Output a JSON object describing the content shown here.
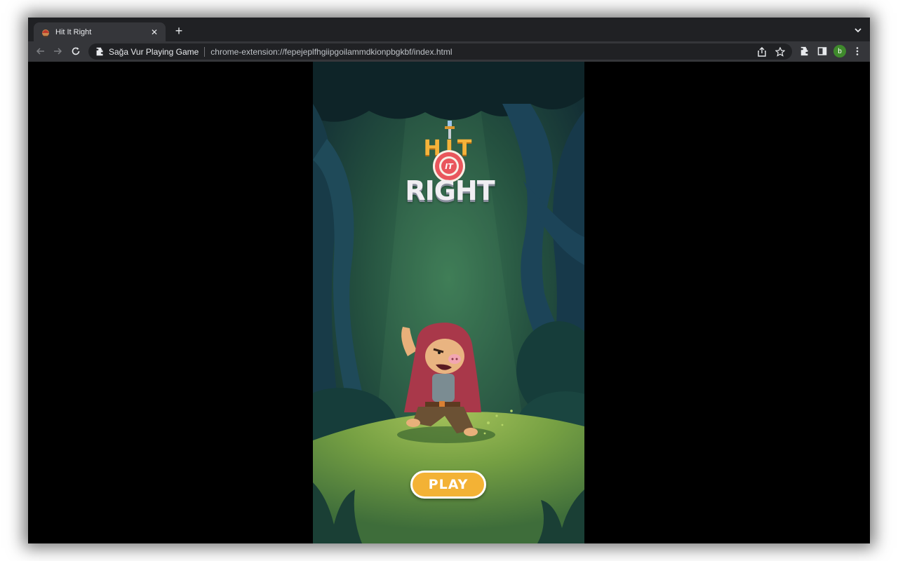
{
  "browser": {
    "tab": {
      "title": "Hit It Right",
      "favicon": "game-favicon-icon",
      "close_icon": "close-icon"
    },
    "new_tab_icon": "plus-icon",
    "tab_search_icon": "chevron-down-icon",
    "nav": {
      "back_icon": "arrow-left-icon",
      "forward_icon": "arrow-right-icon",
      "reload_icon": "reload-icon"
    },
    "omnibox": {
      "site_name": "Sağa Vur Playing Game",
      "url": "chrome-extension://fepejeplfhgiipgoilammdkionpbgkbf/index.html",
      "extension_icon": "puzzle-icon",
      "share_icon": "share-icon",
      "bookmark_icon": "star-icon"
    },
    "toolbar_right": {
      "extensions_icon": "puzzle-icon",
      "side_panel_icon": "side-panel-icon",
      "profile_initial": "b",
      "menu_icon": "kebab-menu-icon"
    }
  },
  "game": {
    "logo": {
      "line1": "HIT",
      "badge": "IT",
      "line2": "RIGHT"
    },
    "play_label": "PLAY"
  },
  "colors": {
    "tabstrip": "#202124",
    "toolbar": "#35363a",
    "play_button": "#f3b235",
    "forest_dark": "#0f2a2e",
    "grass": "#7fa846"
  }
}
